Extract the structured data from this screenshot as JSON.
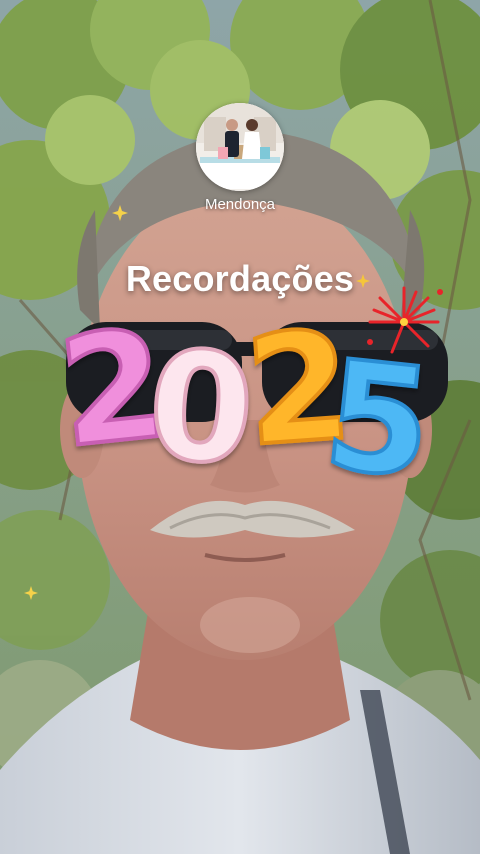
{
  "story": {
    "username": "Mendonça",
    "title": "Recordações",
    "year_sticker": [
      "2",
      "0",
      "2",
      "5"
    ]
  },
  "colors": {
    "digit_1": "#f08fdc",
    "digit_2": "#fde6ee",
    "digit_3": "#ffb62b",
    "digit_4": "#4db8f5",
    "firework": "#e8242a"
  }
}
